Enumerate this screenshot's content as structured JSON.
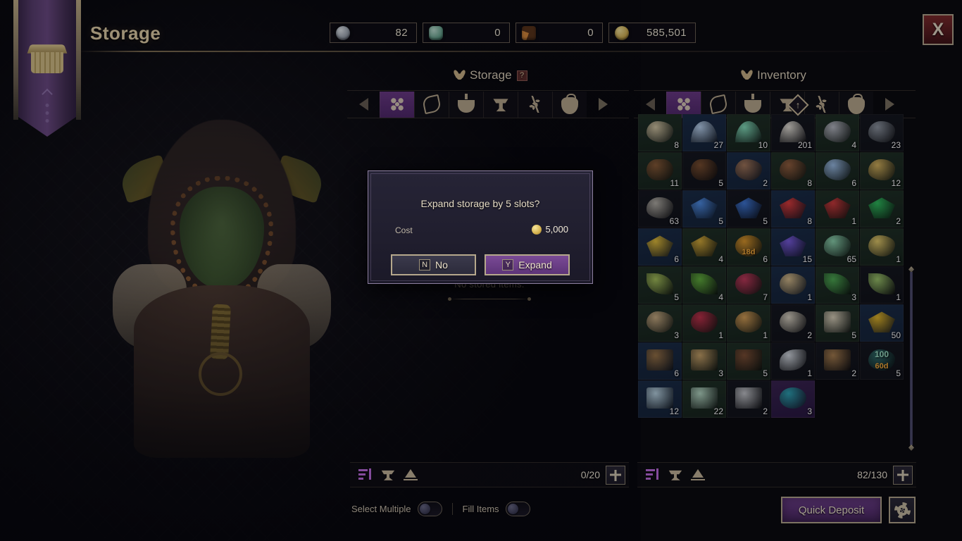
{
  "window": {
    "title": "Storage",
    "close_label": "X"
  },
  "currencies": [
    {
      "icon": "silver-coin-icon",
      "type": "silver",
      "value": "82"
    },
    {
      "icon": "jade-token-icon",
      "type": "jade",
      "value": "0"
    },
    {
      "icon": "pizza-slice-icon",
      "type": "pizza",
      "value": "0"
    },
    {
      "icon": "gold-coin-icon",
      "type": "gold",
      "value": "585,501"
    }
  ],
  "storage_panel": {
    "title": "Storage",
    "help_badge": "?",
    "empty_message": "No stored items.",
    "tabs": [
      {
        "name": "all-items",
        "icon": "diamonds",
        "active": true
      },
      {
        "name": "weapons",
        "icon": "bow",
        "active": false
      },
      {
        "name": "potions",
        "icon": "potion",
        "active": false
      },
      {
        "name": "materials",
        "icon": "anvil",
        "active": false
      },
      {
        "name": "herbs",
        "icon": "herb",
        "active": false
      },
      {
        "name": "pouches",
        "icon": "pouch",
        "active": false
      }
    ],
    "footer": {
      "capacity": "0/20",
      "add_label": "+"
    }
  },
  "inventory_panel": {
    "title": "Inventory",
    "tabs": [
      {
        "name": "all-items",
        "icon": "diamonds",
        "active": true
      },
      {
        "name": "weapons",
        "icon": "bow",
        "active": false
      },
      {
        "name": "potions",
        "icon": "potion",
        "active": false
      },
      {
        "name": "materials",
        "icon": "anvil",
        "active": false
      },
      {
        "name": "herbs",
        "icon": "herb",
        "active": false
      },
      {
        "name": "pouches",
        "icon": "pouch",
        "active": false
      }
    ],
    "footer": {
      "capacity": "82/130",
      "add_label": "+"
    },
    "items": [
      {
        "qty": "8",
        "bg": "green",
        "art": "a-blob",
        "color": "#d8cba6"
      },
      {
        "qty": "27",
        "bg": "blue",
        "art": "a-powder",
        "color": "#bcd6f2"
      },
      {
        "qty": "10",
        "bg": "green",
        "art": "a-powder",
        "color": "#86e3bd"
      },
      {
        "qty": "201",
        "bg": "dark",
        "art": "a-powder",
        "color": "#e8e4da"
      },
      {
        "qty": "4",
        "bg": "green",
        "art": "a-rock",
        "color": "#b9bcc4"
      },
      {
        "qty": "23",
        "bg": "dark",
        "art": "a-rock",
        "color": "#9098a2"
      },
      {
        "qty": "11",
        "bg": "green",
        "art": "a-log",
        "color": "#8a5c36"
      },
      {
        "qty": "5",
        "bg": "dark",
        "art": "a-log",
        "color": "#7b4f2e"
      },
      {
        "qty": "2",
        "bg": "blue",
        "art": "a-blob",
        "color": "#a5785a"
      },
      {
        "qty": "8",
        "bg": "green",
        "art": "a-blob",
        "color": "#96613e"
      },
      {
        "qty": "6",
        "bg": "green",
        "art": "a-blob",
        "color": "#9dc0e8"
      },
      {
        "qty": "12",
        "bg": "green",
        "art": "a-rock",
        "color": "#d8b55c"
      },
      {
        "qty": "63",
        "bg": "dark",
        "art": "a-rock",
        "color": "#b6b2a8"
      },
      {
        "qty": "5",
        "bg": "blue",
        "art": "a-gem",
        "color": "#4f8fe8"
      },
      {
        "qty": "5",
        "bg": "dark",
        "art": "a-gem",
        "color": "#3f78d8"
      },
      {
        "qty": "8",
        "bg": "blue",
        "art": "a-gem",
        "color": "#e03c3c"
      },
      {
        "qty": "1",
        "bg": "green",
        "art": "a-gem",
        "color": "#d03a3a"
      },
      {
        "qty": "2",
        "bg": "green",
        "art": "a-gem",
        "color": "#2fbf5c"
      },
      {
        "qty": "6",
        "bg": "blue",
        "art": "a-gem",
        "color": "#e8c23a"
      },
      {
        "qty": "4",
        "bg": "green",
        "art": "a-gem",
        "color": "#d9ae38"
      },
      {
        "qty": "6",
        "bg": "green",
        "art": "a-round",
        "color": "#e09a2a",
        "timer": "18d"
      },
      {
        "qty": "15",
        "bg": "blue",
        "art": "a-gem",
        "color": "#7a5ce0"
      },
      {
        "qty": "65",
        "bg": "green",
        "art": "a-rock",
        "color": "#8fd8b0"
      },
      {
        "qty": "1",
        "bg": "green",
        "art": "a-blob",
        "color": "#e8cf6a"
      },
      {
        "qty": "5",
        "bg": "green",
        "art": "a-leaf",
        "color": "#a8c45a"
      },
      {
        "qty": "4",
        "bg": "green",
        "art": "a-leaf",
        "color": "#63b23c"
      },
      {
        "qty": "7",
        "bg": "green",
        "art": "a-round",
        "color": "#c43a5a"
      },
      {
        "qty": "1",
        "bg": "blue",
        "art": "a-blob",
        "color": "#d9bf8c"
      },
      {
        "qty": "3",
        "bg": "green",
        "art": "a-leaf",
        "color": "#4fae52"
      },
      {
        "qty": "1",
        "bg": "dark",
        "art": "a-leaf",
        "color": "#9ec86a"
      },
      {
        "qty": "3",
        "bg": "green",
        "art": "a-blob",
        "color": "#cdb083"
      },
      {
        "qty": "1",
        "bg": "green",
        "art": "a-blob",
        "color": "#c2324a"
      },
      {
        "qty": "1",
        "bg": "green",
        "art": "a-round",
        "color": "#d9a256"
      },
      {
        "qty": "2",
        "bg": "dark",
        "art": "a-blob",
        "color": "#ddd6c4"
      },
      {
        "qty": "5",
        "bg": "green",
        "art": "a-scroll",
        "color": "#ded5bc"
      },
      {
        "qty": "50",
        "bg": "blue",
        "art": "a-gem",
        "color": "#e6b929"
      },
      {
        "qty": "6",
        "bg": "blue",
        "art": "a-box",
        "color": "#9a7446"
      },
      {
        "qty": "3",
        "bg": "green",
        "art": "a-box",
        "color": "#c9a468"
      },
      {
        "qty": "5",
        "bg": "green",
        "art": "a-box",
        "color": "#7d4f33"
      },
      {
        "qty": "1",
        "bg": "dark",
        "art": "a-fish",
        "color": "#d6dce2"
      },
      {
        "qty": "2",
        "bg": "dark",
        "art": "a-box",
        "color": "#a97f4e"
      },
      {
        "qty": "5",
        "bg": "dark",
        "art": "a-blob",
        "color": "#2f6c68",
        "buff": "100",
        "timer": "60d"
      },
      {
        "qty": "12",
        "bg": "blue",
        "art": "a-box",
        "color": "#bcd8e6"
      },
      {
        "qty": "22",
        "bg": "green",
        "art": "a-box",
        "color": "#b8ddc6"
      },
      {
        "qty": "2",
        "bg": "dark",
        "art": "a-box",
        "color": "#c6c8cc"
      },
      {
        "qty": "3",
        "bg": "purple",
        "art": "a-round",
        "color": "#2ea3b4"
      }
    ]
  },
  "modal": {
    "question": "Expand storage by 5 slots?",
    "cost_label": "Cost",
    "cost_value": "5,000",
    "buttons": [
      {
        "name": "no-button",
        "key": "N",
        "label": "No",
        "style": "no"
      },
      {
        "name": "expand-button",
        "key": "Y",
        "label": "Expand",
        "style": "yes"
      }
    ]
  },
  "toggles": [
    {
      "name": "select-multiple-toggle",
      "label": "Select Multiple",
      "on": false
    },
    {
      "name": "fill-items-toggle",
      "label": "Fill Items",
      "on": false
    }
  ],
  "actions": {
    "quick_deposit": "Quick Deposit",
    "settings_icon": "gear-icon"
  }
}
